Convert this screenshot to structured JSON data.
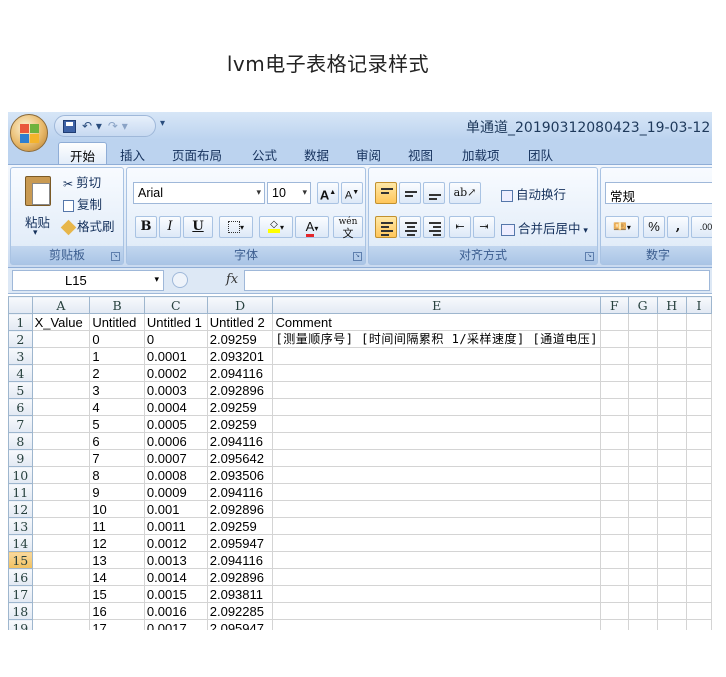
{
  "page_title": "lvm电子表格记录样式",
  "window": {
    "title": "单通道_20190312080423_19-03-12"
  },
  "tabs": [
    {
      "label": "开始",
      "active": true
    },
    {
      "label": "插入"
    },
    {
      "label": "页面布局"
    },
    {
      "label": "公式"
    },
    {
      "label": "数据"
    },
    {
      "label": "审阅"
    },
    {
      "label": "视图"
    },
    {
      "label": "加载项"
    },
    {
      "label": "团队"
    }
  ],
  "ribbon": {
    "clipboard": {
      "paste": "粘贴",
      "cut": "剪切",
      "copy": "复制",
      "format_painter": "格式刷",
      "group": "剪贴板"
    },
    "font": {
      "name": "Arial",
      "size": "10",
      "grow": "A",
      "shrink": "A",
      "bold": "B",
      "italic": "I",
      "underline": "U",
      "font_color": "A",
      "phonetic": "wén",
      "group": "字体"
    },
    "alignment": {
      "wrap": "自动换行",
      "merge": "合并后居中",
      "group": "对齐方式"
    },
    "number": {
      "format": "常规",
      "percent": "%",
      "comma": ",",
      "decimal": ".00",
      "group": "数字"
    }
  },
  "formula_bar": {
    "name_box": "L15",
    "fx": "fx",
    "value": ""
  },
  "sheet": {
    "columns": [
      "",
      "A",
      "B",
      "C",
      "D",
      "E",
      "F",
      "G",
      "H",
      "I"
    ],
    "selected_row": 15,
    "rows": [
      {
        "n": "1",
        "cells": [
          "X_Value",
          "Untitled",
          "Untitled 1",
          "Untitled 2",
          "Comment",
          "",
          "",
          "",
          ""
        ]
      },
      {
        "n": "2",
        "cells": [
          "",
          "0",
          "0",
          "2.09259",
          "[测量顺序号]  [时间间隔累积 1/采样速度] [通道电压]",
          "",
          "",
          "",
          ""
        ]
      },
      {
        "n": "3",
        "cells": [
          "",
          "1",
          "0.0001",
          "2.093201",
          "",
          "",
          "",
          "",
          ""
        ]
      },
      {
        "n": "4",
        "cells": [
          "",
          "2",
          "0.0002",
          "2.094116",
          "",
          "",
          "",
          "",
          ""
        ]
      },
      {
        "n": "5",
        "cells": [
          "",
          "3",
          "0.0003",
          "2.092896",
          "",
          "",
          "",
          "",
          ""
        ]
      },
      {
        "n": "6",
        "cells": [
          "",
          "4",
          "0.0004",
          "2.09259",
          "",
          "",
          "",
          "",
          ""
        ]
      },
      {
        "n": "7",
        "cells": [
          "",
          "5",
          "0.0005",
          "2.09259",
          "",
          "",
          "",
          "",
          ""
        ]
      },
      {
        "n": "8",
        "cells": [
          "",
          "6",
          "0.0006",
          "2.094116",
          "",
          "",
          "",
          "",
          ""
        ]
      },
      {
        "n": "9",
        "cells": [
          "",
          "7",
          "0.0007",
          "2.095642",
          "",
          "",
          "",
          "",
          ""
        ]
      },
      {
        "n": "10",
        "cells": [
          "",
          "8",
          "0.0008",
          "2.093506",
          "",
          "",
          "",
          "",
          ""
        ]
      },
      {
        "n": "11",
        "cells": [
          "",
          "9",
          "0.0009",
          "2.094116",
          "",
          "",
          "",
          "",
          ""
        ]
      },
      {
        "n": "12",
        "cells": [
          "",
          "10",
          "0.001",
          "2.092896",
          "",
          "",
          "",
          "",
          ""
        ]
      },
      {
        "n": "13",
        "cells": [
          "",
          "11",
          "0.0011",
          "2.09259",
          "",
          "",
          "",
          "",
          ""
        ]
      },
      {
        "n": "14",
        "cells": [
          "",
          "12",
          "0.0012",
          "2.095947",
          "",
          "",
          "",
          "",
          ""
        ]
      },
      {
        "n": "15",
        "cells": [
          "",
          "13",
          "0.0013",
          "2.094116",
          "",
          "",
          "",
          "",
          ""
        ]
      },
      {
        "n": "16",
        "cells": [
          "",
          "14",
          "0.0014",
          "2.092896",
          "",
          "",
          "",
          "",
          ""
        ]
      },
      {
        "n": "17",
        "cells": [
          "",
          "15",
          "0.0015",
          "2.093811",
          "",
          "",
          "",
          "",
          ""
        ]
      },
      {
        "n": "18",
        "cells": [
          "",
          "16",
          "0.0016",
          "2.092285",
          "",
          "",
          "",
          "",
          ""
        ]
      },
      {
        "n": "19",
        "cells": [
          "",
          "17",
          "0.0017",
          "2.095947",
          "",
          "",
          "",
          "",
          ""
        ]
      }
    ]
  }
}
